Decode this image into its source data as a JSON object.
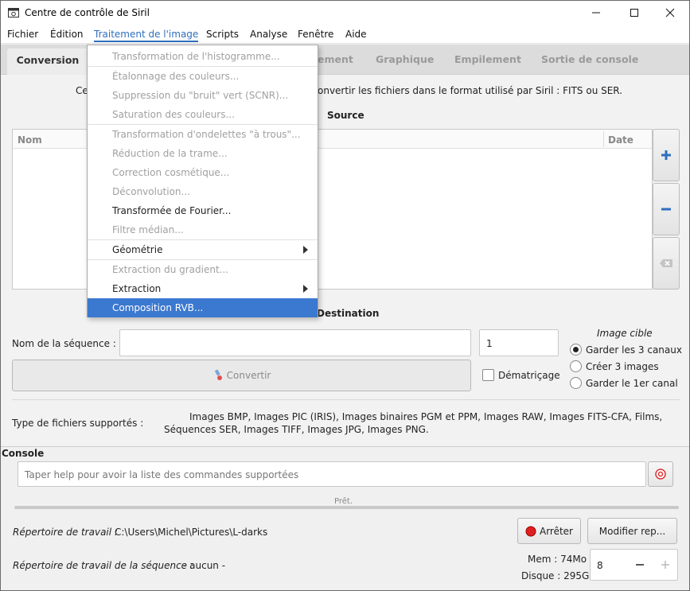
{
  "window": {
    "title": "Centre de contrôle de Siril"
  },
  "menubar": {
    "items": [
      "Fichier",
      "Édition",
      "Traitement de l'image",
      "Scripts",
      "Analyse",
      "Fenêtre",
      "Aide"
    ]
  },
  "tabs": [
    "Conversion",
    "ement",
    "Graphique",
    "Empilement",
    "Sortie de console"
  ],
  "conversion": {
    "intro_left": "Ce",
    "intro_right": "onvertir les fichiers dans le format utilisé par Siril : FITS ou SER.",
    "source_title": "Source",
    "col_name": "Nom",
    "col_date": "Date",
    "destination_title": "Destination",
    "seq_name_label": "Nom de la séquence :",
    "seq_name_value": "",
    "start_index": "1",
    "convert_button": "Convertir",
    "debayer_label": "Dématriçage",
    "debayer_checked": false,
    "target_image_title": "Image cible",
    "target_options": [
      "Garder les 3 canaux",
      "Créer 3 images",
      "Garder le 1er canal"
    ],
    "target_selected": "Garder les 3 canaux",
    "supported_label": "Type de fichiers supportés :",
    "supported_line1": "Images BMP, Images PIC (IRIS), Images binaires PGM et PPM, Images RAW, Images FITS-CFA, Films,",
    "supported_line2": "Séquences SER, Images TIFF, Images JPG, Images PNG."
  },
  "console": {
    "title": "Console",
    "input_placeholder": "Taper help pour avoir la liste des commandes supportées",
    "status": "Prêt.",
    "workdir_label": "Répertoire de travail :",
    "workdir_value": "C:\\Users\\Michel\\Pictures\\L-darks",
    "seq_workdir_label": "Répertoire de travail de la séquence :",
    "seq_workdir_value": "- aucun -",
    "stop_button": "Arrêter",
    "modify_button": "Modifier rep...",
    "mem": "Mem : 74Mo",
    "disk": "Disque : 295G",
    "threads_value": "8"
  },
  "dropdown": {
    "items": [
      {
        "label": "Transformation de l'histogramme...",
        "enabled": false
      },
      {
        "label": "Étalonnage des couleurs...",
        "enabled": false
      },
      {
        "label": "Suppression du \"bruit\" vert (SCNR)...",
        "enabled": false
      },
      {
        "label": "Saturation des couleurs...",
        "enabled": false
      },
      {
        "label": "Transformation d'ondelettes \"à trous\"...",
        "enabled": false
      },
      {
        "label": "Réduction de la trame...",
        "enabled": false
      },
      {
        "label": "Correction cosmétique...",
        "enabled": false
      },
      {
        "label": "Déconvolution...",
        "enabled": false
      },
      {
        "label": "Transformée de Fourier...",
        "enabled": true
      },
      {
        "label": "Filtre médian...",
        "enabled": false
      },
      {
        "label": "Géométrie",
        "enabled": true
      },
      {
        "label": "Extraction du gradient...",
        "enabled": false
      },
      {
        "label": "Extraction",
        "enabled": true
      },
      {
        "label": "Composition RVB...",
        "enabled": true
      }
    ]
  },
  "colors": {
    "accent": "#3b78d0",
    "menu_active": "#2f6fbe",
    "stop_red": "#e02020"
  }
}
